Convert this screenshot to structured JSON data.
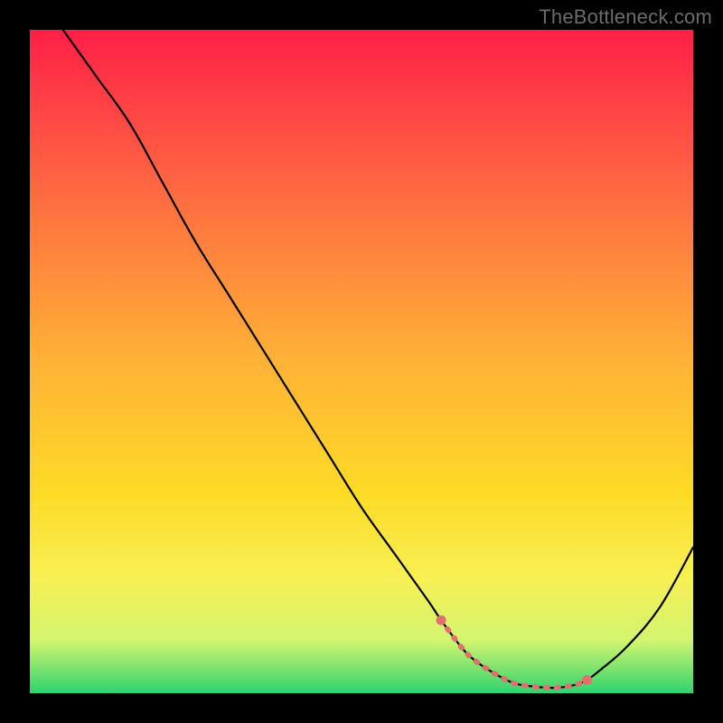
{
  "watermark": "TheBottleneck.com",
  "chart_data": {
    "type": "line",
    "title": "",
    "xlabel": "",
    "ylabel": "",
    "xlim": [
      0,
      100
    ],
    "ylim": [
      0,
      100
    ],
    "grid": false,
    "legend": false,
    "series": [
      {
        "name": "curve",
        "x": [
          5,
          10,
          15,
          20,
          25,
          30,
          35,
          40,
          45,
          50,
          55,
          60,
          62,
          65,
          67,
          70,
          73,
          76,
          79,
          82,
          84,
          86,
          90,
          95,
          100
        ],
        "y": [
          100,
          93,
          86,
          77,
          68,
          60,
          52,
          44,
          36,
          28,
          21,
          14,
          11,
          7,
          5,
          3,
          1.5,
          1,
          0.8,
          1.2,
          2,
          3.5,
          7,
          13,
          22
        ]
      }
    ],
    "markers": {
      "name": "highlight-band",
      "color": "#e0716f",
      "x": [
        62,
        65,
        67,
        70,
        73,
        76,
        79,
        82,
        84
      ],
      "y": [
        11,
        7,
        5,
        3,
        1.5,
        1,
        0.8,
        1.2,
        2
      ]
    }
  }
}
